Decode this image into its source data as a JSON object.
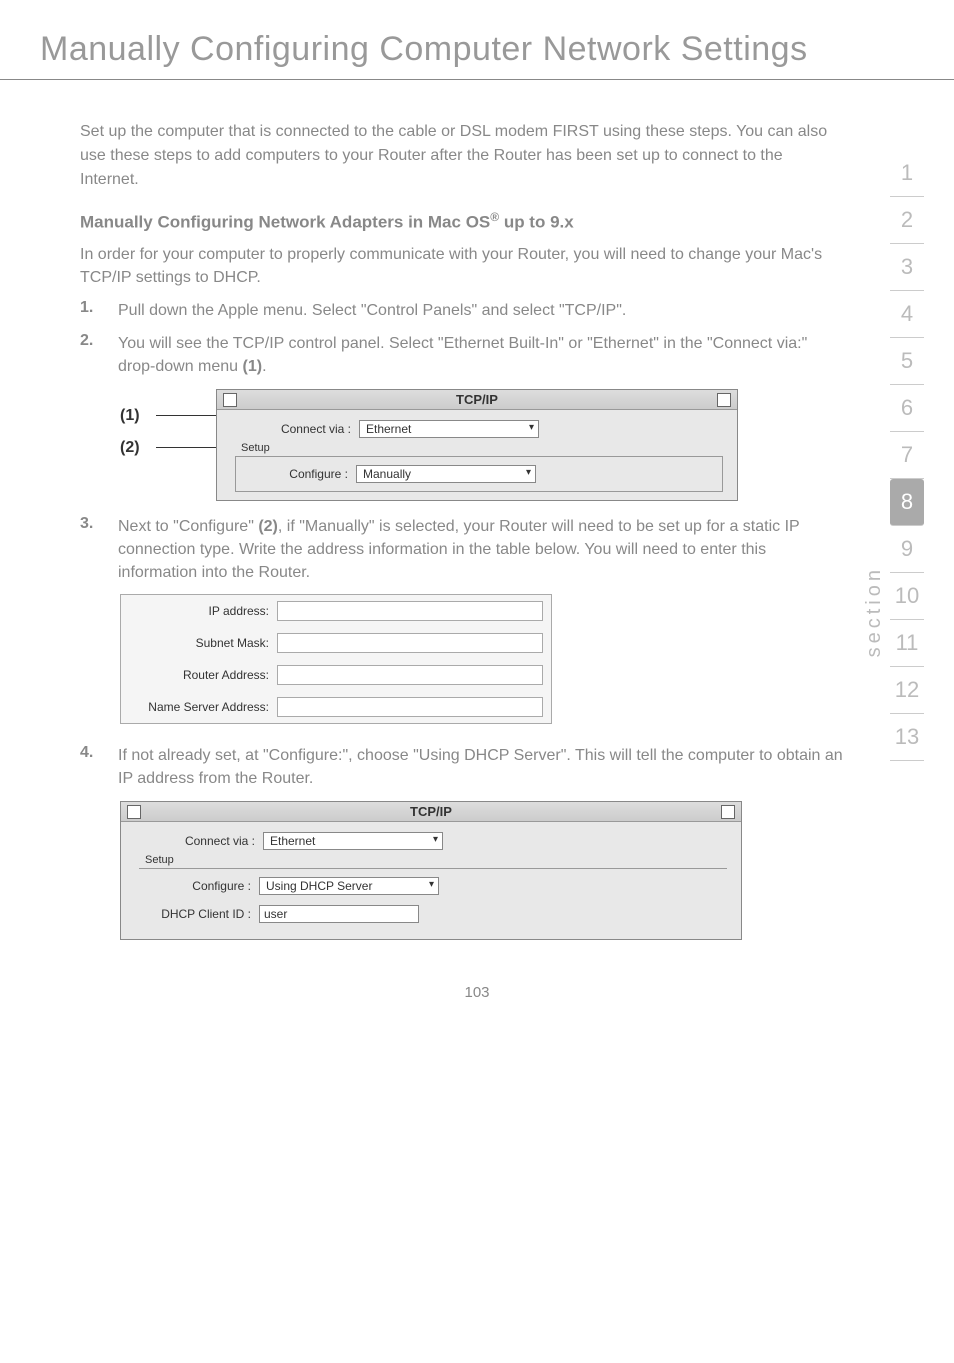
{
  "page_title": "Manually Configuring Computer Network Settings",
  "intro": "Set up the computer that is connected to the cable or DSL modem FIRST using these steps. You can also use these steps to add computers to your Router after the Router has been set up to connect to the Internet.",
  "section_heading_pre": "Manually Configuring Network Adapters in Mac OS",
  "section_heading_sup": "®",
  "section_heading_post": " up to 9.x",
  "sub_intro": "In order for your computer to properly communicate with your Router, you will need to change your Mac's TCP/IP settings to DHCP.",
  "steps": [
    {
      "num": "1.",
      "text": "Pull down the Apple menu. Select \"Control Panels\" and select \"TCP/IP\"."
    },
    {
      "num": "2.",
      "text_a": "You will see the TCP/IP control panel. Select \"Ethernet Built-In\" or \"Ethernet\" in the \"Connect via:\" drop-down menu ",
      "bold": "(1)",
      "text_b": "."
    },
    {
      "num": "3.",
      "text_a": "Next to \"Configure\" ",
      "bold": "(2)",
      "text_b": ", if \"Manually\" is selected, your Router will need to be set up for a static IP connection type. Write the address information in the table below. You will need to enter this information into the Router."
    },
    {
      "num": "4.",
      "text": "If not already set, at \"Configure:\", choose \"Using DHCP Server\". This will tell the computer to obtain an IP address from the Router."
    }
  ],
  "callouts": {
    "one": "(1)",
    "two": "(2)"
  },
  "fig1": {
    "title": "TCP/IP",
    "connect_via_label": "Connect via :",
    "connect_via_value": "Ethernet",
    "setup_label": "Setup",
    "configure_label": "Configure :",
    "configure_value": "Manually"
  },
  "ip_table": {
    "rows": [
      "IP address:",
      "Subnet Mask:",
      "Router Address:",
      "Name Server Address:"
    ]
  },
  "fig2": {
    "title": "TCP/IP",
    "connect_via_label": "Connect via :",
    "connect_via_value": "Ethernet",
    "setup_label": "Setup",
    "configure_label": "Configure :",
    "configure_value": "Using DHCP Server",
    "dhcp_id_label": "DHCP Client ID :",
    "dhcp_id_value": "user"
  },
  "sidebar": {
    "label": "section",
    "items": [
      "1",
      "2",
      "3",
      "4",
      "5",
      "6",
      "7",
      "8",
      "9",
      "10",
      "11",
      "12",
      "13"
    ],
    "active": "8"
  },
  "page_num": "103"
}
